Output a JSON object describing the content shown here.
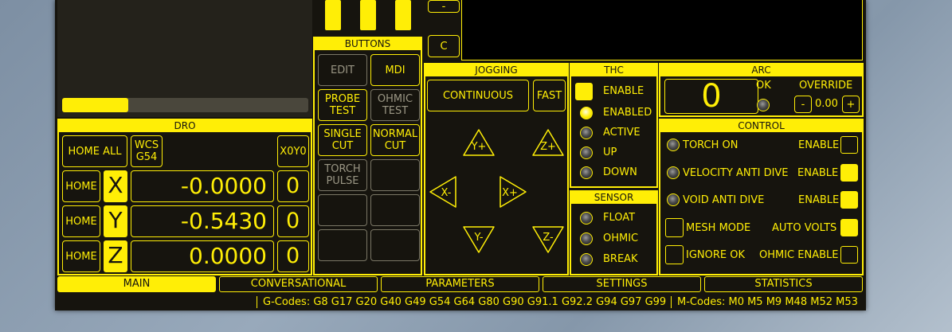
{
  "left_panel": {
    "progress_percent": 27
  },
  "buttons_panel": {
    "header": "BUTTONS",
    "edit": "EDIT",
    "mdi": "MDI",
    "probe_test": [
      "PROBE",
      "TEST"
    ],
    "ohmic_test": [
      "OHMIC",
      "TEST"
    ],
    "single_cut": [
      "SINGLE",
      "CUT"
    ],
    "normal_cut": [
      "NORMAL",
      "CUT"
    ],
    "torch_pulse": [
      "TORCH",
      "PULSE"
    ]
  },
  "top_controls": {
    "minus": "-",
    "c": "C"
  },
  "jogging": {
    "header": "JOGGING",
    "mode": "CONTINUOUS",
    "fast": "FAST",
    "yplus": "Y+",
    "zplus": "Z+",
    "xminus": "X-",
    "xplus": "X+",
    "yminus": "Y-",
    "zminus": "Z-"
  },
  "thc": {
    "header": "THC",
    "enable": "ENABLE",
    "enabled": "ENABLED",
    "active": "ACTIVE",
    "up": "UP",
    "down": "DOWN",
    "enable_checked": true
  },
  "sensor": {
    "header": "SENSOR",
    "float": "FLOAT",
    "ohmic": "OHMIC",
    "break": "BREAK"
  },
  "arc": {
    "header": "ARC",
    "value": "0",
    "ok": "OK",
    "override": "OVERRIDE",
    "minus": "-",
    "override_value": "0.00",
    "plus": "+"
  },
  "control": {
    "header": "CONTROL",
    "torch_on": "TORCH ON",
    "enable": "ENABLE",
    "velocity_anti_dive": "VELOCITY ANTI DIVE",
    "void_anti_dive": "VOID ANTI DIVE",
    "mesh_mode": "MESH MODE",
    "auto_volts": "AUTO VOLTS",
    "ignore_ok": "IGNORE OK",
    "ohmic_enable": "OHMIC ENABLE"
  },
  "dro": {
    "header": "DRO",
    "home_all": "HOME ALL",
    "wcs_line1": "WCS",
    "wcs_line2": "G54",
    "x0y0": "X0Y0",
    "rows": [
      {
        "home": "HOME",
        "axis": "X",
        "value": "-0.0000",
        "wcs": "0"
      },
      {
        "home": "HOME",
        "axis": "Y",
        "value": "-0.5430",
        "wcs": "0"
      },
      {
        "home": "HOME",
        "axis": "Z",
        "value": "0.0000",
        "wcs": "0"
      }
    ]
  },
  "tabs": [
    "MAIN",
    "CONVERSATIONAL",
    "PARAMETERS",
    "SETTINGS",
    "STATISTICS"
  ],
  "status": {
    "gcodes": "G-Codes: G8 G17 G20 G40 G49 G54 G64 G80 G90 G91.1 G92.2 G94 G97 G99",
    "mcodes": "M-Codes: M0 M5 M9 M48 M52 M53"
  },
  "colors": {
    "accent": "#ffee06",
    "background": "#16140e",
    "disabled": "#7b7766"
  }
}
